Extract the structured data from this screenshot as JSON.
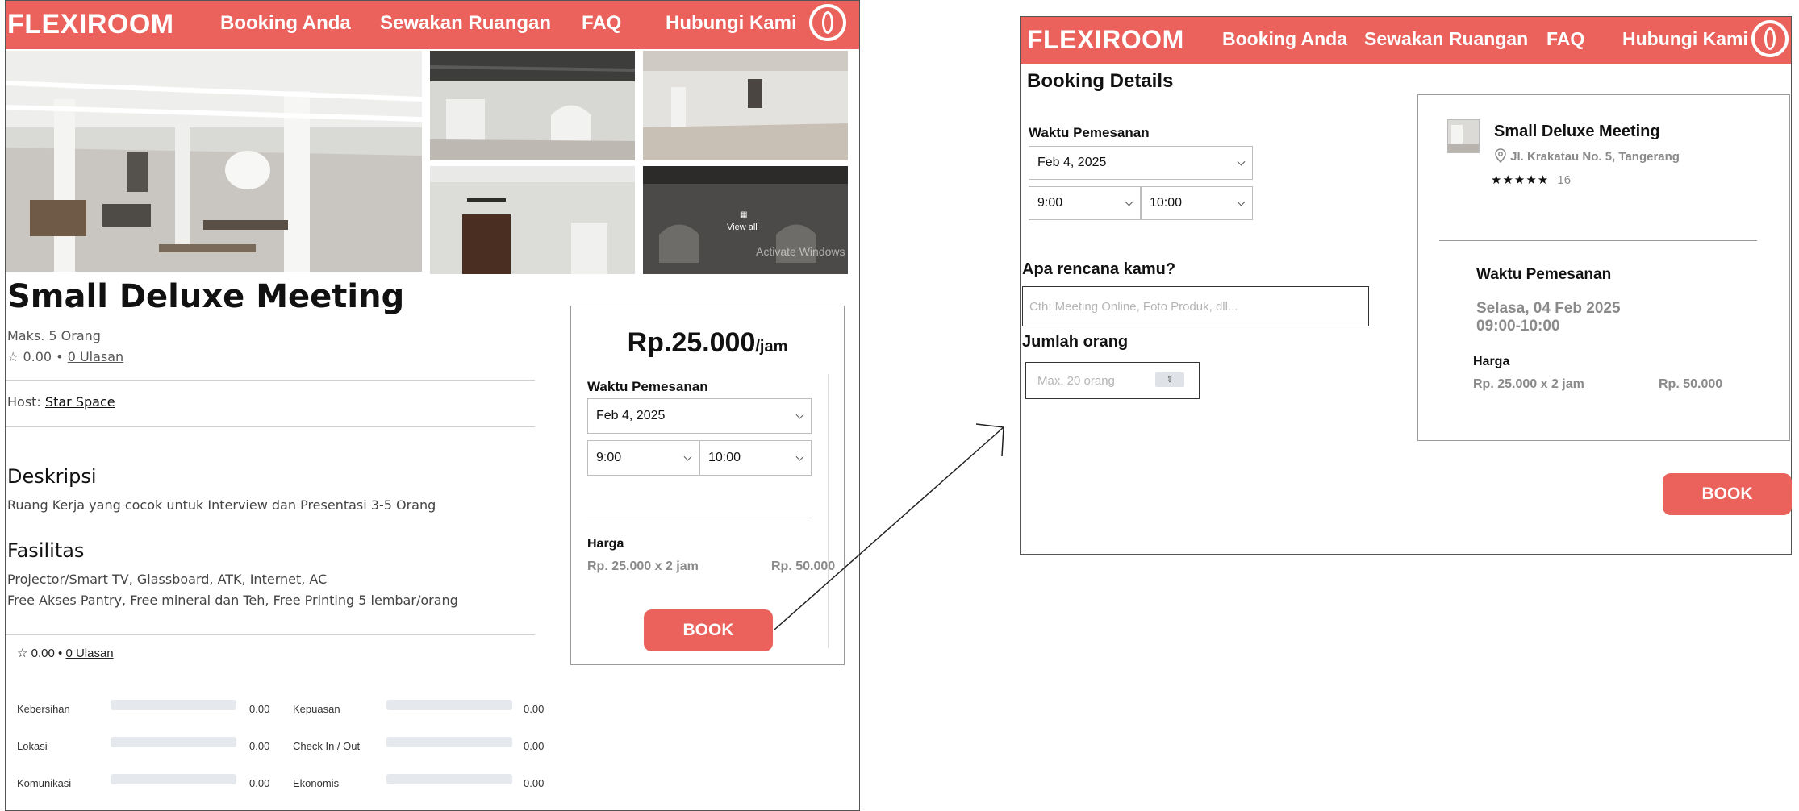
{
  "brand": {
    "name": "FLEXIROOM",
    "accent": "#ea625b"
  },
  "nav": {
    "links": [
      "Booking Anda",
      "Sewakan Ruangan",
      "FAQ",
      "Hubungi Kami"
    ],
    "profile_icon": "user-icon"
  },
  "gallery": {
    "view_all": "View all",
    "watermark": "Activate Windows"
  },
  "room": {
    "title": "Small Deluxe Meeting",
    "capacity": "Maks. 5 Orang",
    "rating": "0.00",
    "reviews_link": "0 Ulasan",
    "host_label": "Host:",
    "host_name": "Star Space",
    "desc_heading": "Deskripsi",
    "desc_text": "Ruang Kerja yang cocok untuk Interview dan Presentasi 3-5 Orang",
    "facilities_heading": "Fasilitas",
    "facilities": [
      "Projector/Smart TV, Glassboard, ATK, Internet, AC",
      "Free Akses Pantry, Free mineral dan Teh, Free Printing 5 lembar/orang"
    ]
  },
  "ratings": {
    "summary_value": "0.00",
    "summary_link": "0 Ulasan",
    "items": [
      {
        "label": "Kebersihan",
        "value": "0.00",
        "fill": 0
      },
      {
        "label": "Kepuasan",
        "value": "0.00",
        "fill": 0
      },
      {
        "label": "Lokasi",
        "value": "0.00",
        "fill": 0
      },
      {
        "label": "Check In / Out",
        "value": "0.00",
        "fill": 0
      },
      {
        "label": "Komunikasi",
        "value": "0.00",
        "fill": 0
      },
      {
        "label": "Ekonomis",
        "value": "0.00",
        "fill": 0
      }
    ]
  },
  "booking_card": {
    "price": "Rp.25.000",
    "unit": "/jam",
    "time_label": "Waktu Pemesanan",
    "date": "Feb 4, 2025",
    "start": "9:00",
    "end": "10:00",
    "price_label": "Harga",
    "price_calc": "Rp. 25.000 x 2 jam",
    "price_total": "Rp. 50.000",
    "book": "BOOK"
  },
  "details": {
    "heading": "Booking Details",
    "time_label": "Waktu Pemesanan",
    "date": "Feb 4, 2025",
    "start": "9:00",
    "end": "10:00",
    "plan_label": "Apa rencana kamu?",
    "plan_placeholder": "Cth: Meeting Online, Foto Produk, dll...",
    "people_label": "Jumlah orang",
    "people_placeholder": "Max. 20 orang",
    "book": "BOOK"
  },
  "summary": {
    "title": "Small Deluxe Meeting",
    "address": "Jl. Krakatau No. 5, Tangerang",
    "stars": 5,
    "review_count": "16",
    "time_label": "Waktu Pemesanan",
    "date_text": "Selasa, 04 Feb 2025",
    "time_text": "09:00-10:00",
    "price_label": "Harga",
    "price_calc": "Rp. 25.000 x 2 jam",
    "price_total": "Rp. 50.000"
  }
}
